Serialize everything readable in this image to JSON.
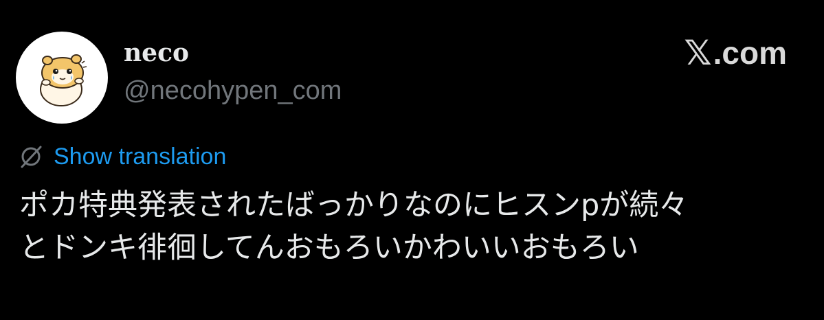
{
  "author": {
    "name": "neco",
    "handle": "@necohypen_com"
  },
  "brand": {
    "label_x": "𝕏",
    "label_suffix": ".com"
  },
  "translation": {
    "label": "Show translation"
  },
  "post": {
    "text": "ポカ特典発表されたばっかりなのにヒスンpが続々\nとドンキ徘徊してんおもろいかわいいおもろい"
  },
  "colors": {
    "background": "#000000",
    "primary_text": "#e7e9ea",
    "secondary_text": "#71767b",
    "link": "#1d9bf0"
  },
  "icons": {
    "avatar": "hamster-avatar",
    "translate": "globe-slash-icon"
  }
}
